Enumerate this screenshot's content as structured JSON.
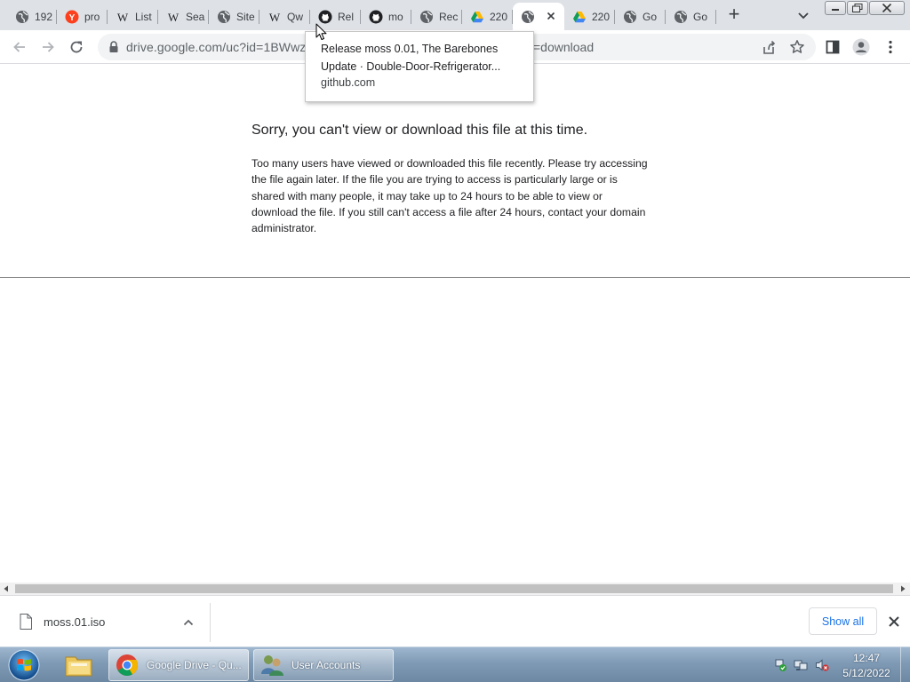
{
  "browser": {
    "tabs": [
      {
        "title": "192",
        "icon": "globe-icon"
      },
      {
        "title": "pro",
        "icon": "yandex-icon"
      },
      {
        "title": "List",
        "icon": "wikipedia-icon"
      },
      {
        "title": "Sea",
        "icon": "wikipedia-icon"
      },
      {
        "title": "Site",
        "icon": "globe-icon"
      },
      {
        "title": "Qw",
        "icon": "wikipedia-icon"
      },
      {
        "title": "Rel",
        "icon": "github-icon"
      },
      {
        "title": "mo",
        "icon": "github-icon"
      },
      {
        "title": "Rec",
        "icon": "globe-icon"
      },
      {
        "title": "220",
        "icon": "google-drive-icon"
      },
      {
        "title": "",
        "icon": "globe-icon",
        "active": true
      },
      {
        "title": "220",
        "icon": "google-drive-icon"
      },
      {
        "title": "Go",
        "icon": "globe-icon"
      },
      {
        "title": "Go",
        "icon": "globe-icon"
      }
    ],
    "new_tab_label": "+",
    "address": {
      "url_visible_start": "drive.google.com/uc?id=1BWwz",
      "url_visible_end": "=download"
    },
    "tooltip": {
      "title": "Release moss 0.01, The Barebones Update · Double-Door-Refrigerator...",
      "domain": "github.com"
    }
  },
  "page": {
    "error_title": "Sorry, you can't view or download this file at this time.",
    "error_body": "Too many users have viewed or downloaded this file recently. Please try accessing the file again later. If the file you are trying to access is particularly large or is shared with many people, it may take up to 24 hours to be able to view or download the file. If you still can't access a file after 24 hours, contact your domain administrator."
  },
  "download_shelf": {
    "file_name": "moss.01.iso",
    "show_all_label": "Show all"
  },
  "taskbar": {
    "buttons": [
      {
        "label": "Google Drive - Qu...",
        "icon": "chrome-icon"
      },
      {
        "label": "User Accounts",
        "icon": "user-accounts-icon"
      }
    ],
    "clock_time": "12:47",
    "clock_date": "5/12/2022"
  },
  "colors": {
    "tabstrip_bg": "#dee1e6",
    "link_blue": "#1a73e8",
    "taskbar_blue": "#7f9ab5"
  }
}
